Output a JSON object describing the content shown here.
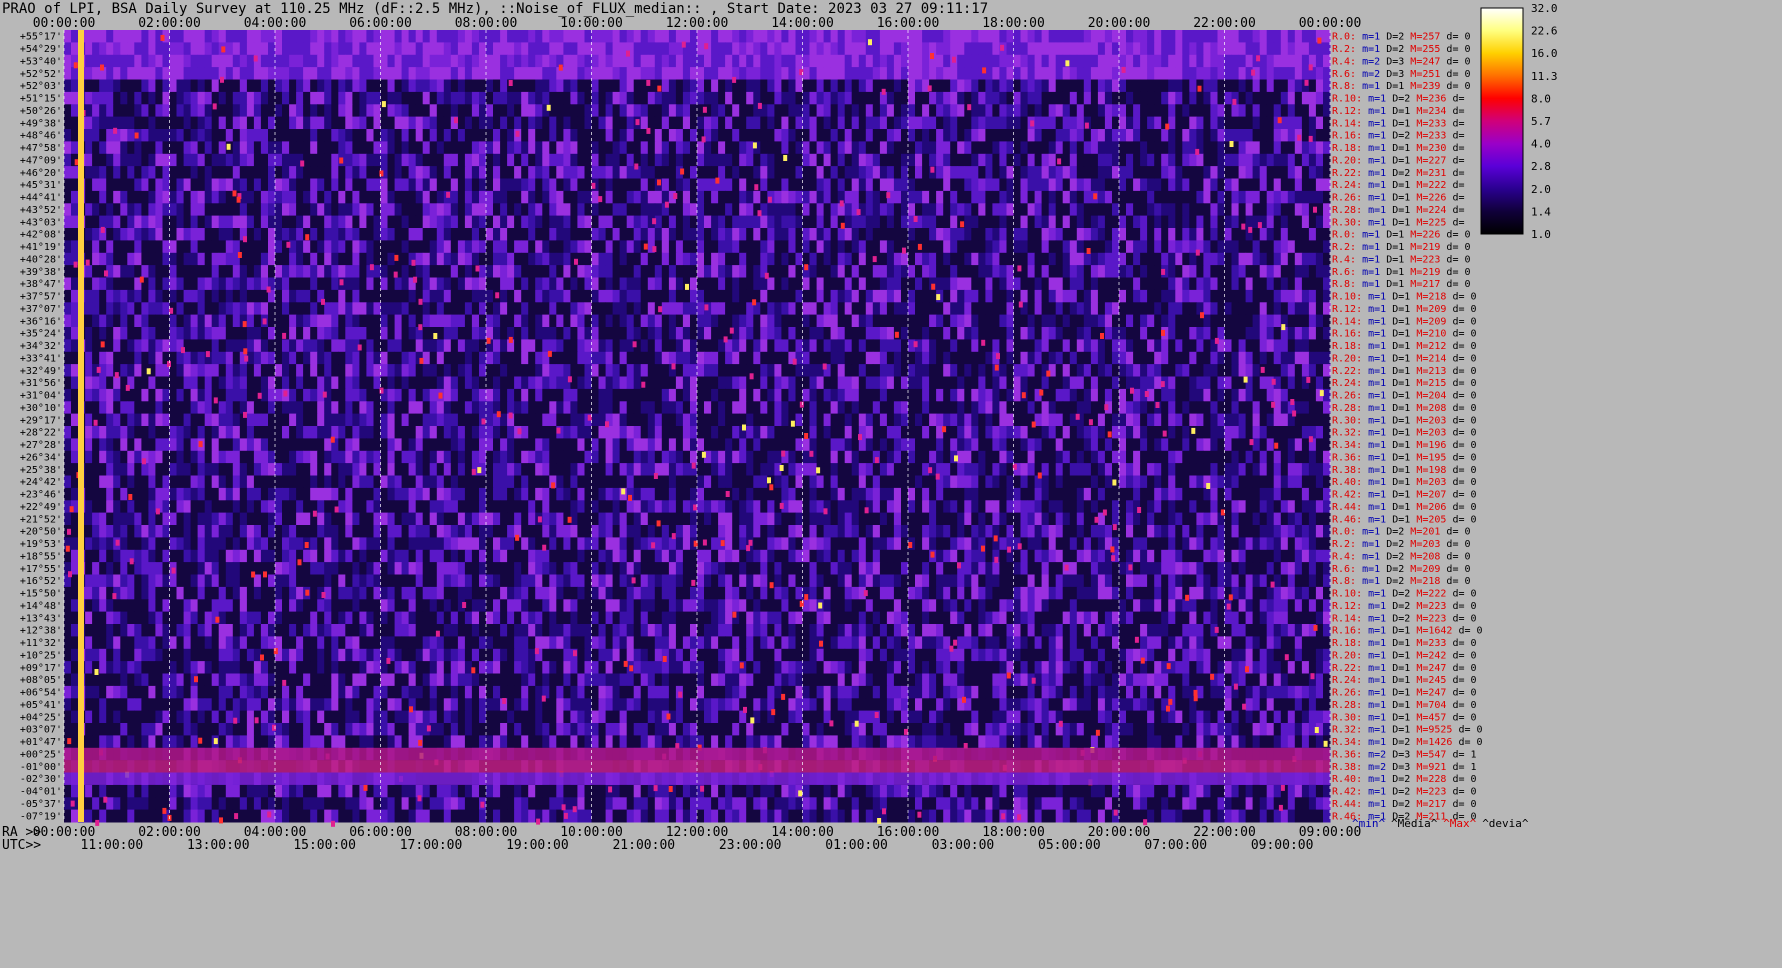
{
  "title": "PRAO of LPI, BSA Daily Survey at 110.25 MHz (dF::2.5 MHz), ::Noise_of_FLUX_median:: , Start Date: 2023 03 27 09:11:17",
  "chart_data": {
    "type": "heatmap",
    "title": "PRAO of LPI, BSA Daily Survey at 110.25 MHz (dF::2.5 MHz), ::Noise_of_FLUX_median:: , Start Date: 2023 03 27 09:11:17",
    "x_top_ticks": [
      "00:00:00",
      "02:00:00",
      "04:00:00",
      "06:00:00",
      "08:00:00",
      "10:00:00",
      "12:00:00",
      "14:00:00",
      "16:00:00",
      "18:00:00",
      "20:00:00",
      "22:00:00",
      "00:00:00"
    ],
    "x_bottom_ra_prefix": "RA >>",
    "x_bottom_ra_ticks": [
      "00:00:00",
      "02:00:00",
      "04:00:00",
      "06:00:00",
      "08:00:00",
      "10:00:00",
      "12:00:00",
      "14:00:00",
      "16:00:00",
      "18:00:00",
      "20:00:00",
      "22:00:00",
      "09:00:00"
    ],
    "x_bottom_utc_prefix": "UTC>>",
    "x_bottom_utc_ticks": [
      "11:00:00",
      "13:00:00",
      "15:00:00",
      "17:00:00",
      "19:00:00",
      "21:00:00",
      "23:00:00",
      "01:00:00",
      "03:00:00",
      "05:00:00",
      "07:00:00",
      "09:00:00"
    ],
    "y_dec_ticks": [
      "+55°17'",
      "+54°29'",
      "+53°40'",
      "+52°52'",
      "+52°03'",
      "+51°15'",
      "+50°26'",
      "+49°38'",
      "+48°46'",
      "+47°58'",
      "+47°09'",
      "+46°20'",
      "+45°31'",
      "+44°41'",
      "+43°52'",
      "+43°03'",
      "+42°08'",
      "+41°19'",
      "+40°28'",
      "+39°38'",
      "+38°47'",
      "+37°57'",
      "+37°07'",
      "+36°16'",
      "+35°24'",
      "+34°32'",
      "+33°41'",
      "+32°49'",
      "+31°56'",
      "+31°04'",
      "+30°10'",
      "+29°17'",
      "+28°22'",
      "+27°28'",
      "+26°34'",
      "+25°38'",
      "+24°42'",
      "+23°46'",
      "+22°49'",
      "+21°52'",
      "+20°50'",
      "+19°53'",
      "+18°55'",
      "+17°55'",
      "+16°52'",
      "+15°50'",
      "+14°48'",
      "+13°43'",
      "+12°38'",
      "+11°32'",
      "+10°25'",
      "+09°17'",
      "+08°05'",
      "+06°54'",
      "+05°41'",
      "+04°25'",
      "+03°07'",
      "+01°47'",
      "+00°25'",
      "-01°00'",
      "-02°30'",
      "-04°01'",
      "-05°37'",
      "-07°19'"
    ],
    "row_stats": [
      [
        "R.0:",
        "m=1",
        "D=2",
        "M=257",
        "d= 0"
      ],
      [
        "R.2:",
        "m=1",
        "D=2",
        "M=255",
        "d= 0"
      ],
      [
        "R.4:",
        "m=2",
        "D=3",
        "M=247",
        "d= 0"
      ],
      [
        "R.6:",
        "m=2",
        "D=3",
        "M=251",
        "d= 0"
      ],
      [
        "R.8:",
        "m=1",
        "D=1",
        "M=239",
        "d= 0"
      ],
      [
        "R.10:",
        "m=1",
        "D=2",
        "M=236",
        "d="
      ],
      [
        "R.12:",
        "m=1",
        "D=1",
        "M=234",
        "d="
      ],
      [
        "R.14:",
        "m=1",
        "D=1",
        "M=233",
        "d="
      ],
      [
        "R.16:",
        "m=1",
        "D=2",
        "M=233",
        "d="
      ],
      [
        "R.18:",
        "m=1",
        "D=1",
        "M=230",
        "d="
      ],
      [
        "R.20:",
        "m=1",
        "D=1",
        "M=227",
        "d="
      ],
      [
        "R.22:",
        "m=1",
        "D=2",
        "M=231",
        "d="
      ],
      [
        "R.24:",
        "m=1",
        "D=1",
        "M=222",
        "d="
      ],
      [
        "R.26:",
        "m=1",
        "D=1",
        "M=226",
        "d="
      ],
      [
        "R.28:",
        "m=1",
        "D=1",
        "M=224",
        "d="
      ],
      [
        "R.30:",
        "m=1",
        "D=1",
        "M=225",
        "d="
      ],
      [
        "R.0:",
        "m=1",
        "D=1",
        "M=226",
        "d= 0"
      ],
      [
        "R.2:",
        "m=1",
        "D=1",
        "M=219",
        "d= 0"
      ],
      [
        "R.4:",
        "m=1",
        "D=1",
        "M=223",
        "d= 0"
      ],
      [
        "R.6:",
        "m=1",
        "D=1",
        "M=219",
        "d= 0"
      ],
      [
        "R.8:",
        "m=1",
        "D=1",
        "M=217",
        "d= 0"
      ],
      [
        "R.10:",
        "m=1",
        "D=1",
        "M=218",
        "d= 0"
      ],
      [
        "R.12:",
        "m=1",
        "D=1",
        "M=209",
        "d= 0"
      ],
      [
        "R.14:",
        "m=1",
        "D=1",
        "M=209",
        "d= 0"
      ],
      [
        "R.16:",
        "m=1",
        "D=1",
        "M=210",
        "d= 0"
      ],
      [
        "R.18:",
        "m=1",
        "D=1",
        "M=212",
        "d= 0"
      ],
      [
        "R.20:",
        "m=1",
        "D=1",
        "M=214",
        "d= 0"
      ],
      [
        "R.22:",
        "m=1",
        "D=1",
        "M=213",
        "d= 0"
      ],
      [
        "R.24:",
        "m=1",
        "D=1",
        "M=215",
        "d= 0"
      ],
      [
        "R.26:",
        "m=1",
        "D=1",
        "M=204",
        "d= 0"
      ],
      [
        "R.28:",
        "m=1",
        "D=1",
        "M=208",
        "d= 0"
      ],
      [
        "R.30:",
        "m=1",
        "D=1",
        "M=203",
        "d= 0"
      ],
      [
        "R.32:",
        "m=1",
        "D=1",
        "M=203",
        "d= 0"
      ],
      [
        "R.34:",
        "m=1",
        "D=1",
        "M=196",
        "d= 0"
      ],
      [
        "R.36:",
        "m=1",
        "D=1",
        "M=195",
        "d= 0"
      ],
      [
        "R.38:",
        "m=1",
        "D=1",
        "M=198",
        "d= 0"
      ],
      [
        "R.40:",
        "m=1",
        "D=1",
        "M=203",
        "d= 0"
      ],
      [
        "R.42:",
        "m=1",
        "D=1",
        "M=207",
        "d= 0"
      ],
      [
        "R.44:",
        "m=1",
        "D=1",
        "M=206",
        "d= 0"
      ],
      [
        "R.46:",
        "m=1",
        "D=1",
        "M=205",
        "d= 0"
      ],
      [
        "R.0:",
        "m=1",
        "D=2",
        "M=201",
        "d= 0"
      ],
      [
        "R.2:",
        "m=1",
        "D=2",
        "M=203",
        "d= 0"
      ],
      [
        "R.4:",
        "m=1",
        "D=2",
        "M=208",
        "d= 0"
      ],
      [
        "R.6:",
        "m=1",
        "D=2",
        "M=209",
        "d= 0"
      ],
      [
        "R.8:",
        "m=1",
        "D=2",
        "M=218",
        "d= 0"
      ],
      [
        "R.10:",
        "m=1",
        "D=2",
        "M=222",
        "d= 0"
      ],
      [
        "R.12:",
        "m=1",
        "D=2",
        "M=223",
        "d= 0"
      ],
      [
        "R.14:",
        "m=1",
        "D=2",
        "M=223",
        "d= 0"
      ],
      [
        "R.16:",
        "m=1",
        "D=1",
        "M=1642",
        "d= 0"
      ],
      [
        "R.18:",
        "m=1",
        "D=1",
        "M=233",
        "d= 0"
      ],
      [
        "R.20:",
        "m=1",
        "D=1",
        "M=242",
        "d= 0"
      ],
      [
        "R.22:",
        "m=1",
        "D=1",
        "M=247",
        "d= 0"
      ],
      [
        "R.24:",
        "m=1",
        "D=1",
        "M=245",
        "d= 0"
      ],
      [
        "R.26:",
        "m=1",
        "D=1",
        "M=247",
        "d= 0"
      ],
      [
        "R.28:",
        "m=1",
        "D=1",
        "M=704",
        "d= 0"
      ],
      [
        "R.30:",
        "m=1",
        "D=1",
        "M=457",
        "d= 0"
      ],
      [
        "R.32:",
        "m=1",
        "D=1",
        "M=9525",
        "d= 0"
      ],
      [
        "R.34:",
        "m=1",
        "D=2",
        "M=1426",
        "d= 0"
      ],
      [
        "R.36:",
        "m=2",
        "D=3",
        "M=547",
        "d= 1"
      ],
      [
        "R.38:",
        "m=2",
        "D=3",
        "M=921",
        "d= 1"
      ],
      [
        "R.40:",
        "m=1",
        "D=2",
        "M=228",
        "d= 0"
      ],
      [
        "R.42:",
        "m=1",
        "D=2",
        "M=223",
        "d= 0"
      ],
      [
        "R.44:",
        "m=1",
        "D=2",
        "M=217",
        "d= 0"
      ],
      [
        "R.46:",
        "m=1",
        "D=2",
        "M=211",
        "d= 0"
      ]
    ],
    "stats_legend": [
      "^min^",
      "^Media^",
      "^Max^",
      "^devia^"
    ],
    "colorbar": {
      "ticks": [
        "32.0",
        "22.6",
        "16.0",
        "11.3",
        "8.0",
        "5.7",
        "4.0",
        "2.8",
        "2.0",
        "1.4",
        "1.0"
      ],
      "colors": [
        "#ffffff",
        "#ffff80",
        "#ffd000",
        "#ff7000",
        "#ff0000",
        "#d0007a",
        "#9a00c8",
        "#5a00d8",
        "#2a0090",
        "#10003a",
        "#000000"
      ]
    },
    "colors": {
      "ra_label": "#000000",
      "m_text": "#0000b0",
      "D_text": "#000000",
      "M_text": "#e00000",
      "d_text": "#000000",
      "background": "#b8b8b8"
    }
  }
}
